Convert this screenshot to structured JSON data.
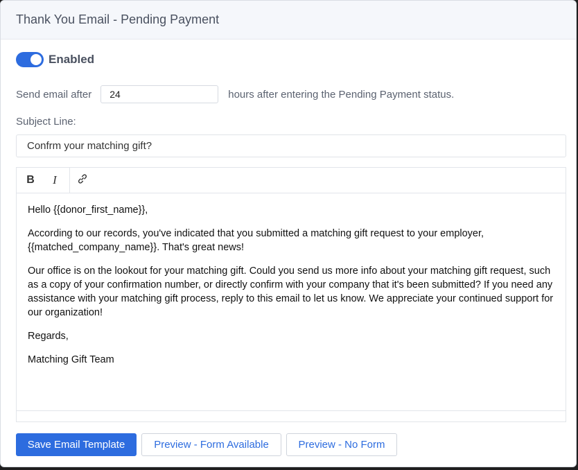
{
  "card": {
    "title": "Thank You Email - Pending Payment"
  },
  "toggle": {
    "label": "Enabled",
    "on": true
  },
  "delay": {
    "prefix": "Send email after",
    "hours_value": "24",
    "suffix": "hours after entering the Pending Payment status."
  },
  "subject": {
    "label": "Subject Line:",
    "value": "Confrm your matching gift?"
  },
  "editor": {
    "toolbar": {
      "bold": "B",
      "italic": "I"
    },
    "paragraphs": [
      "Hello {{donor_first_name}},",
      "According to our records, you've indicated that you submitted a matching gift request to your employer, {{matched_company_name}}. That's great news!",
      "Our office is on the lookout for your matching gift. Could you send us more info about your matching gift request, such as a copy of your confirmation number, or directly confirm with your company that it's been submitted? If you need any assistance with your matching gift process, reply to this email to let us know. We appreciate your continued support for our organization!",
      "Regards,",
      "Matching Gift Team"
    ]
  },
  "actions": {
    "save": "Save Email Template",
    "preview_form": "Preview - Form Available",
    "preview_no_form": "Preview - No Form"
  },
  "colors": {
    "accent": "#2d6cdf",
    "header_bg": "#f5f7fb"
  },
  "icons": {
    "link": "link-icon"
  }
}
